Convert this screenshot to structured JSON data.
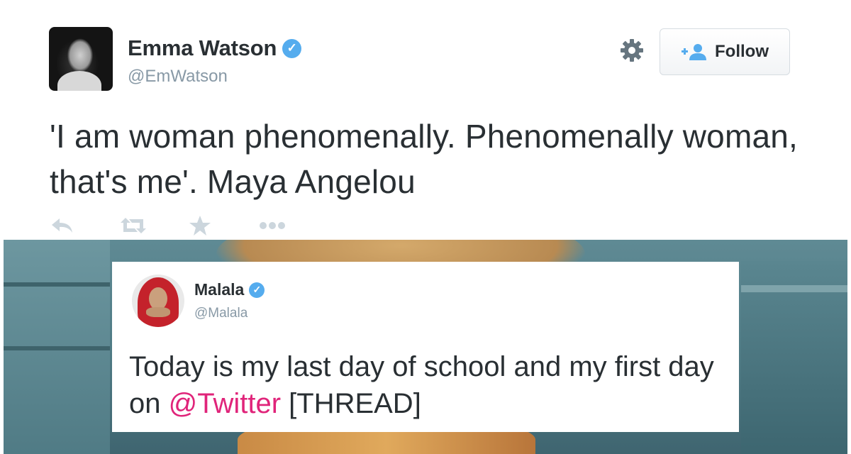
{
  "tweet": {
    "author_name": "Emma Watson",
    "author_handle": "@EmWatson",
    "verified_mark": "✓",
    "follow_label": "Follow",
    "text": "'I am woman phenomenally. Phenomenally woman, that's me'. Maya Angelou",
    "icons": [
      "verified-badge-icon",
      "gear-icon",
      "follow-person-icon",
      "reply-icon",
      "retweet-icon",
      "favorite-star-icon",
      "more-dots-icon"
    ]
  },
  "embedded_tweet": {
    "author_name": "Malala",
    "author_handle": "@Malala",
    "verified_mark": "✓",
    "text_before": "Today is my last day of school and my first day on ",
    "mention": "@Twitter",
    "text_after": " [THREAD]"
  },
  "colors": {
    "verified_blue": "#55acee",
    "mention_pink": "#e0247a",
    "secondary_gray": "#8899a6",
    "action_gray": "#ccd6dd"
  }
}
